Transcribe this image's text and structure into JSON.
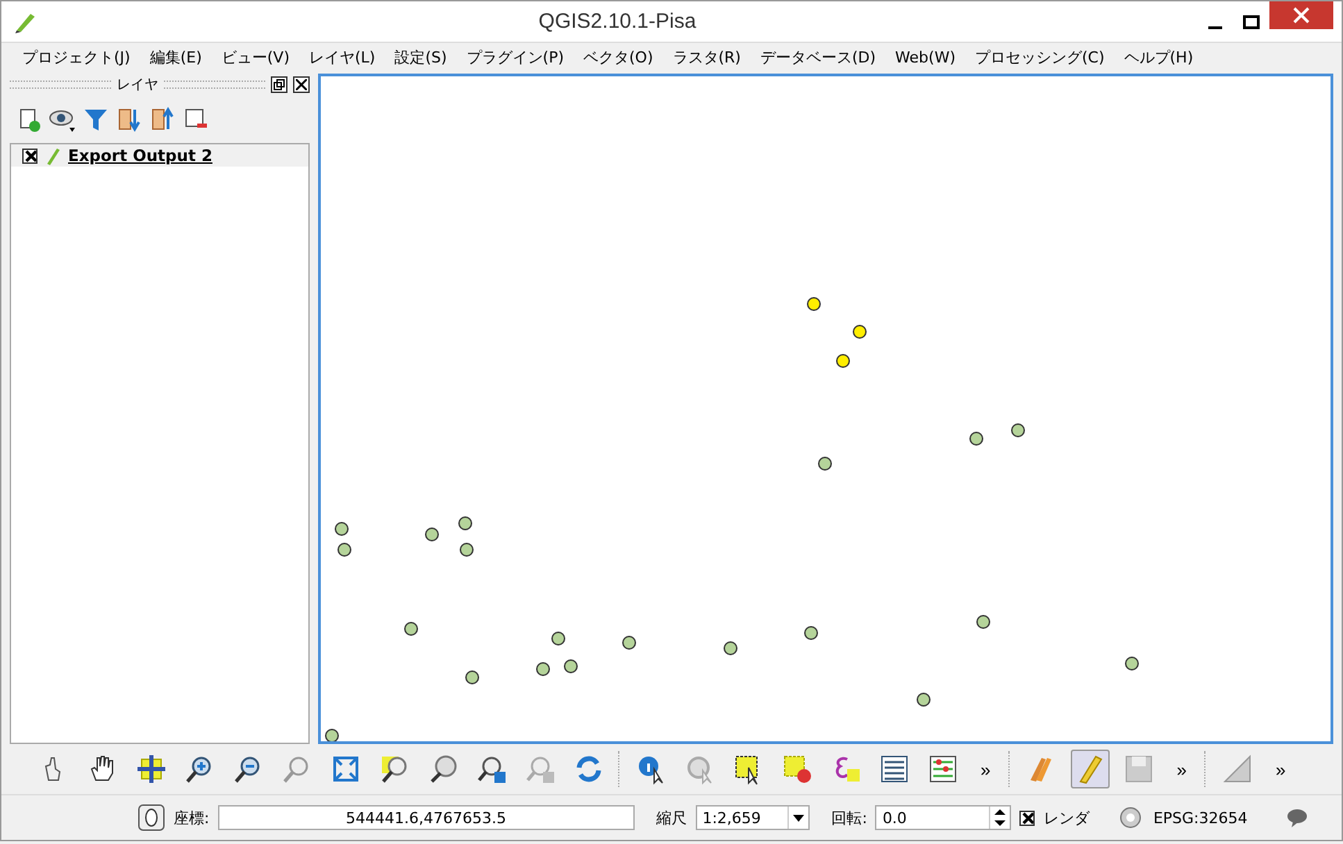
{
  "window": {
    "title": "QGIS2.10.1-Pisa"
  },
  "menu": [
    "プロジェクト(J)",
    "編集(E)",
    "ビュー(V)",
    "レイヤ(L)",
    "設定(S)",
    "プラグイン(P)",
    "ベクタ(O)",
    "ラスタ(R)",
    "データベース(D)",
    "Web(W)",
    "プロセッシング(C)",
    "ヘルプ(H)"
  ],
  "layers_panel": {
    "title": "レイヤ",
    "layers": [
      {
        "name": "Export Output 2",
        "checked": true
      }
    ]
  },
  "map": {
    "points": [
      {
        "selected": true
      },
      {
        "selected": true
      },
      {
        "selected": true
      },
      {
        "selected": false
      },
      {
        "selected": false
      },
      {
        "selected": false
      },
      {
        "selected": false
      },
      {
        "selected": false
      },
      {
        "selected": false
      },
      {
        "selected": false
      },
      {
        "selected": false
      },
      {
        "selected": false
      },
      {
        "selected": false
      },
      {
        "selected": false
      },
      {
        "selected": false
      },
      {
        "selected": false
      },
      {
        "selected": false
      },
      {
        "selected": false
      },
      {
        "selected": false
      },
      {
        "selected": false
      },
      {
        "selected": false
      },
      {
        "selected": false
      },
      {
        "selected": false
      }
    ]
  },
  "toolbar": {
    "overflow": [
      "»",
      "»",
      "»"
    ],
    "edit_toggle": {
      "on": true
    }
  },
  "status_bar": {
    "coordinate_label": "座標:",
    "coordinate": "544441.6,4767653.5",
    "scale_label": "縮尺",
    "scale": "1:2,659",
    "rotation_label": "回転:",
    "rotation": "0.0",
    "render": {
      "label": "レンダ",
      "checked": true
    },
    "crs": "EPSG:32654"
  }
}
